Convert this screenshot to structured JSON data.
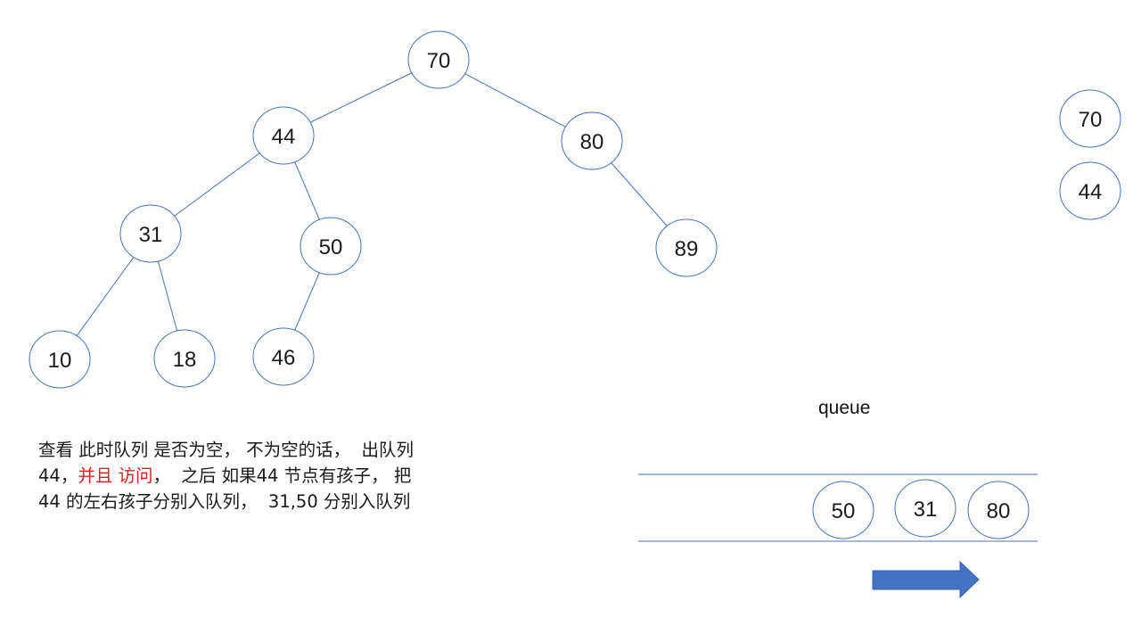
{
  "tree": {
    "nodes": [
      {
        "id": "n70",
        "label": "70"
      },
      {
        "id": "n44",
        "label": "44"
      },
      {
        "id": "n80",
        "label": "80"
      },
      {
        "id": "n31",
        "label": "31"
      },
      {
        "id": "n50",
        "label": "50"
      },
      {
        "id": "n89",
        "label": "89"
      },
      {
        "id": "n10",
        "label": "10"
      },
      {
        "id": "n18",
        "label": "18"
      },
      {
        "id": "n46",
        "label": "46"
      }
    ],
    "edges": [
      [
        "n70",
        "n44"
      ],
      [
        "n70",
        "n80"
      ],
      [
        "n44",
        "n31"
      ],
      [
        "n44",
        "n50"
      ],
      [
        "n80",
        "n89"
      ],
      [
        "n31",
        "n10"
      ],
      [
        "n31",
        "n18"
      ],
      [
        "n50",
        "n46"
      ]
    ]
  },
  "visited": [
    "70",
    "44"
  ],
  "queue": {
    "label": "queue",
    "items": [
      "50",
      "31",
      "80"
    ]
  },
  "description": {
    "line1": "查看 此时队列 是否为空， 不为空的话，  出队列",
    "line2_a": "44，",
    "line2_red": "并且 访问",
    "line2_b": "，  之后 如果44 节点有孩子， 把",
    "line3": "44 的左右孩子分别入队列，  31,50 分别入队列"
  },
  "colors": {
    "stroke": "#4472c4",
    "arrow": "#4472c4",
    "highlight": "#e02020"
  }
}
